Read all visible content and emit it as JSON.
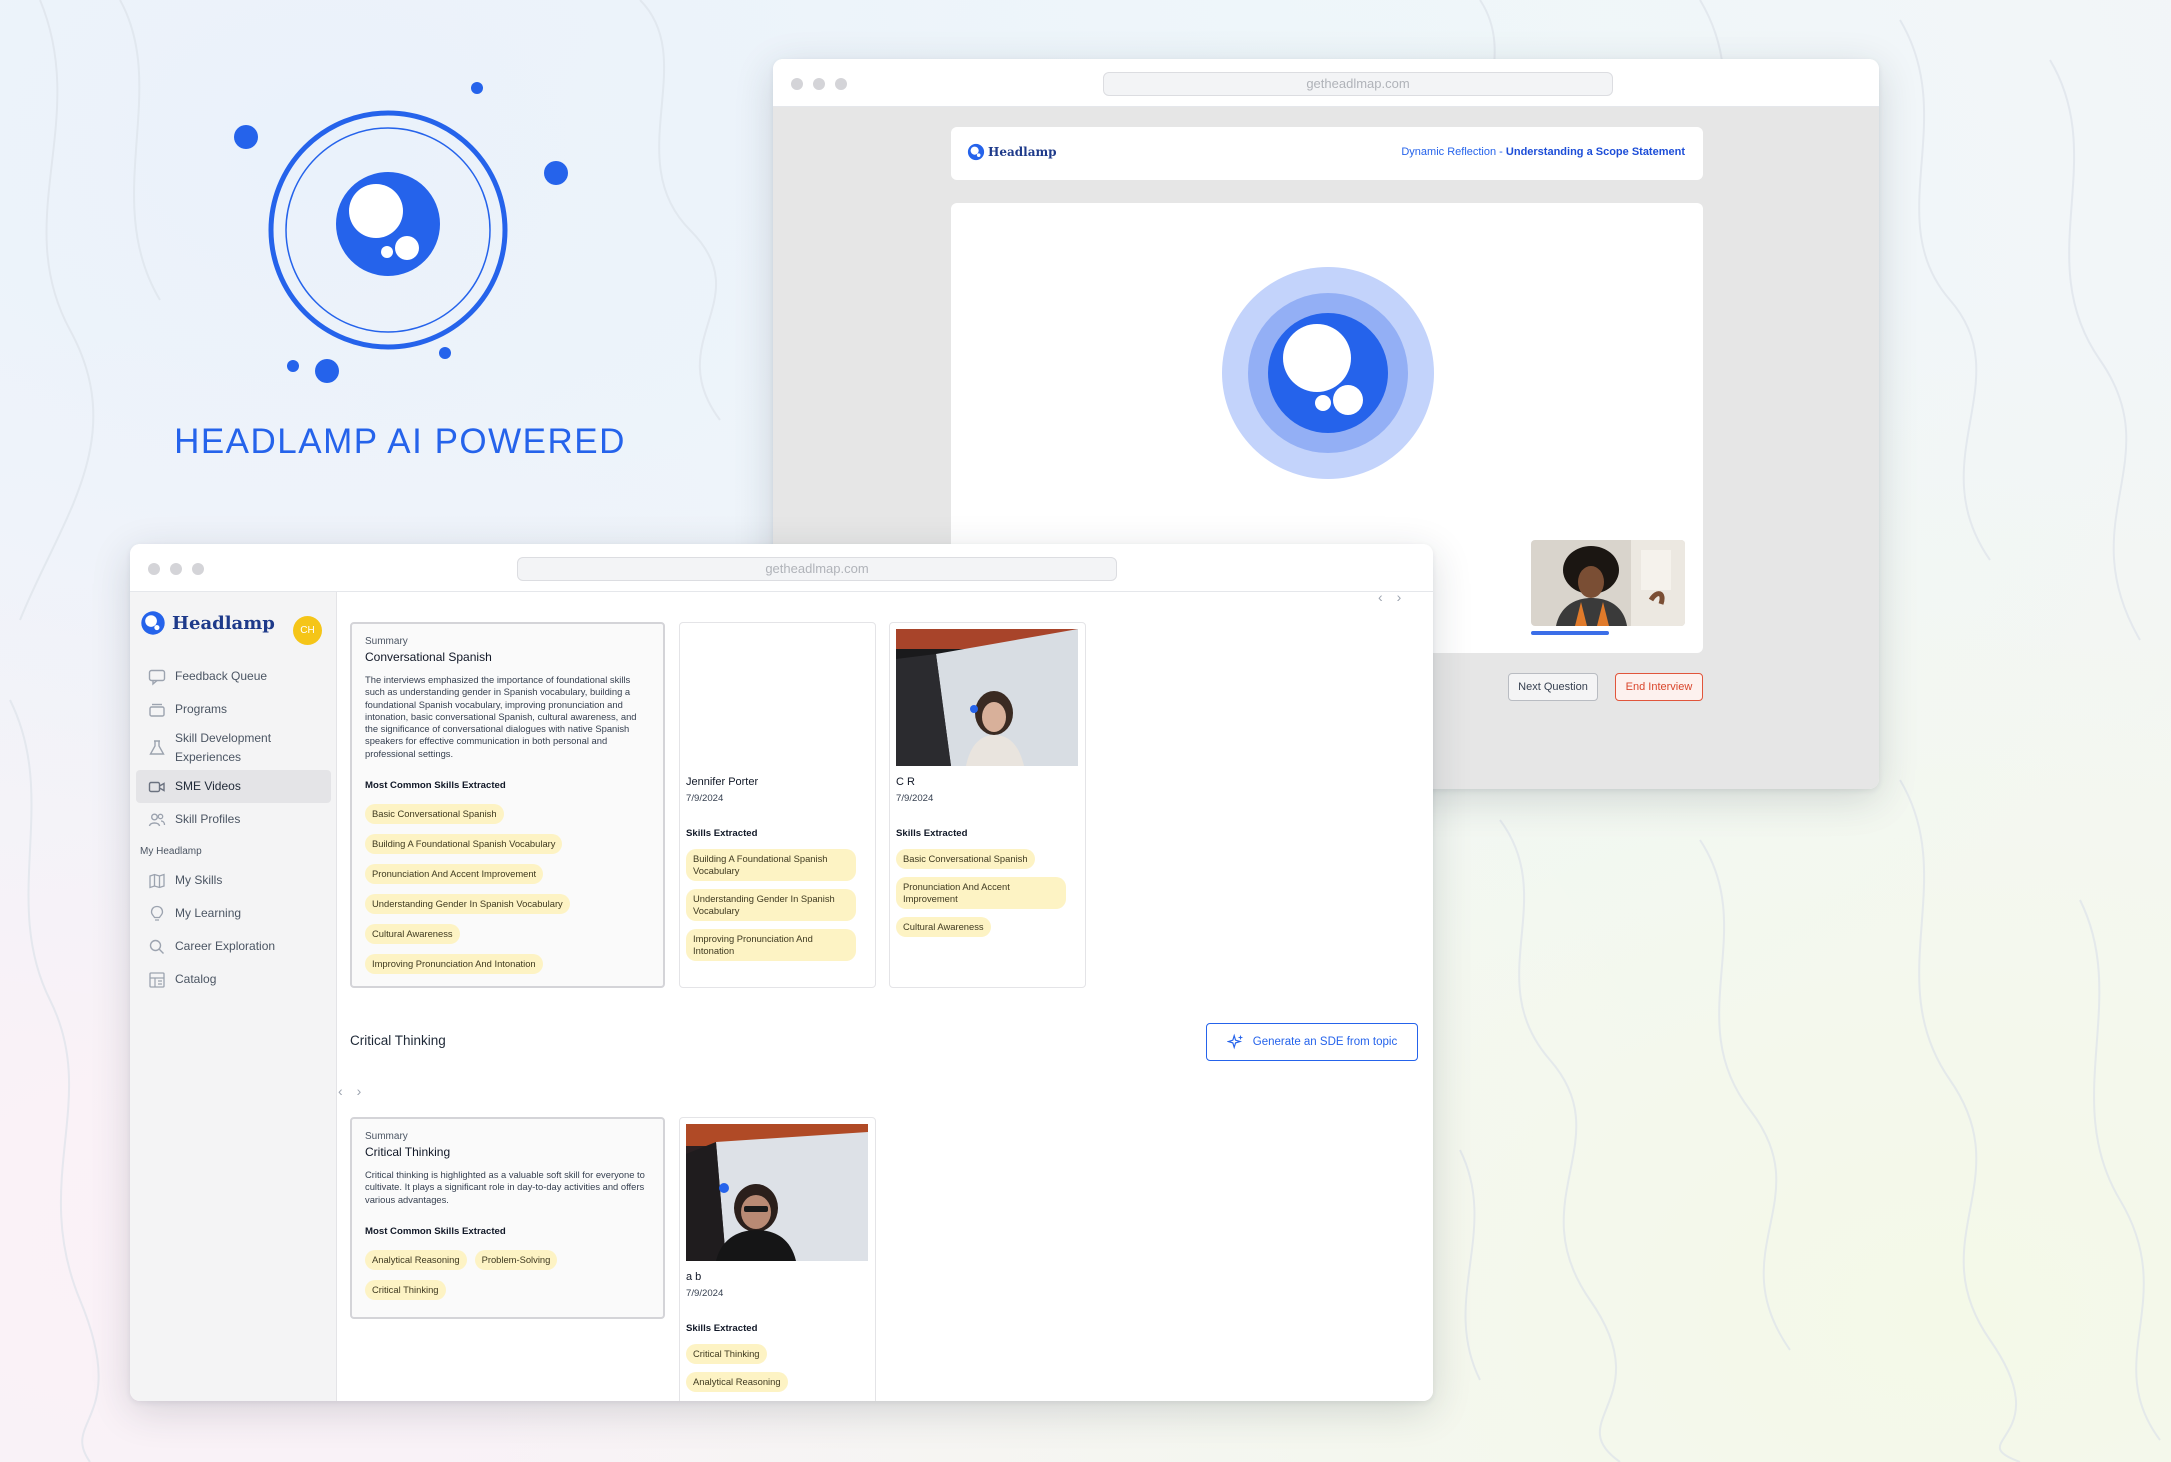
{
  "hero": {
    "title": "HEADLAMP AI POWERED"
  },
  "back_window": {
    "url": "getheadlmap.com",
    "brand": "Headlamp",
    "breadcrumb_prefix": "Dynamic Reflection - ",
    "breadcrumb_current": "Understanding a Scope Statement",
    "next_button": "Next Question",
    "end_button": "End Interview"
  },
  "front_window": {
    "url": "getheadlmap.com",
    "brand": "Headlamp",
    "avatar_initials": "CH",
    "nav": [
      {
        "label": "Feedback Queue",
        "icon": "chat-icon"
      },
      {
        "label": "Programs",
        "icon": "stack-icon"
      },
      {
        "label": "Skill Development Experiences",
        "icon": "flask-icon"
      },
      {
        "label": "SME Videos",
        "icon": "video-icon",
        "active": true
      },
      {
        "label": "Skill Profiles",
        "icon": "users-icon"
      }
    ],
    "section_label": "My Headlamp",
    "nav2": [
      {
        "label": "My Skills",
        "icon": "map-icon"
      },
      {
        "label": "My Learning",
        "icon": "lightbulb-icon"
      },
      {
        "label": "Career Exploration",
        "icon": "search-icon"
      },
      {
        "label": "Catalog",
        "icon": "catalog-icon"
      }
    ],
    "summary_caption": "Summary",
    "most_common_label": "Most Common Skills Extracted",
    "skills_extracted_label": "Skills Extracted",
    "topic1": {
      "title": "Conversational Spanish",
      "description": "The interviews emphasized the importance of foundational skills such as understanding gender in Spanish vocabulary, building a foundational Spanish vocabulary, improving pronunciation and intonation, basic conversational Spanish, cultural awareness, and the significance of conversational dialogues with native Spanish speakers for effective communication in both personal and professional settings.",
      "skills": [
        "Basic Conversational Spanish",
        "Building A Foundational Spanish Vocabulary",
        "Pronunciation And Accent Improvement",
        "Understanding Gender In Spanish Vocabulary",
        "Cultural Awareness",
        "Improving Pronunciation And Intonation"
      ],
      "videos": [
        {
          "name": "Jennifer Porter",
          "date": "7/9/2024",
          "skills": [
            "Building A Foundational Spanish Vocabulary",
            "Understanding Gender In Spanish Vocabulary",
            "Improving Pronunciation And Intonation"
          ]
        },
        {
          "name": "C R",
          "date": "7/9/2024",
          "skills": [
            "Basic Conversational Spanish",
            "Pronunciation And Accent Improvement",
            "Cultural Awareness"
          ]
        }
      ]
    },
    "topic2": {
      "heading": "Critical Thinking",
      "generate_button": "Generate an SDE from topic",
      "title": "Critical Thinking",
      "description": "Critical thinking is highlighted as a valuable soft skill for everyone to cultivate. It plays a significant role in day-to-day activities and offers various advantages.",
      "skills": [
        "Analytical Reasoning",
        "Problem-Solving",
        "Critical Thinking"
      ],
      "videos": [
        {
          "name": "a b",
          "date": "7/9/2024",
          "skills": [
            "Critical Thinking",
            "Analytical Reasoning"
          ]
        }
      ]
    }
  }
}
